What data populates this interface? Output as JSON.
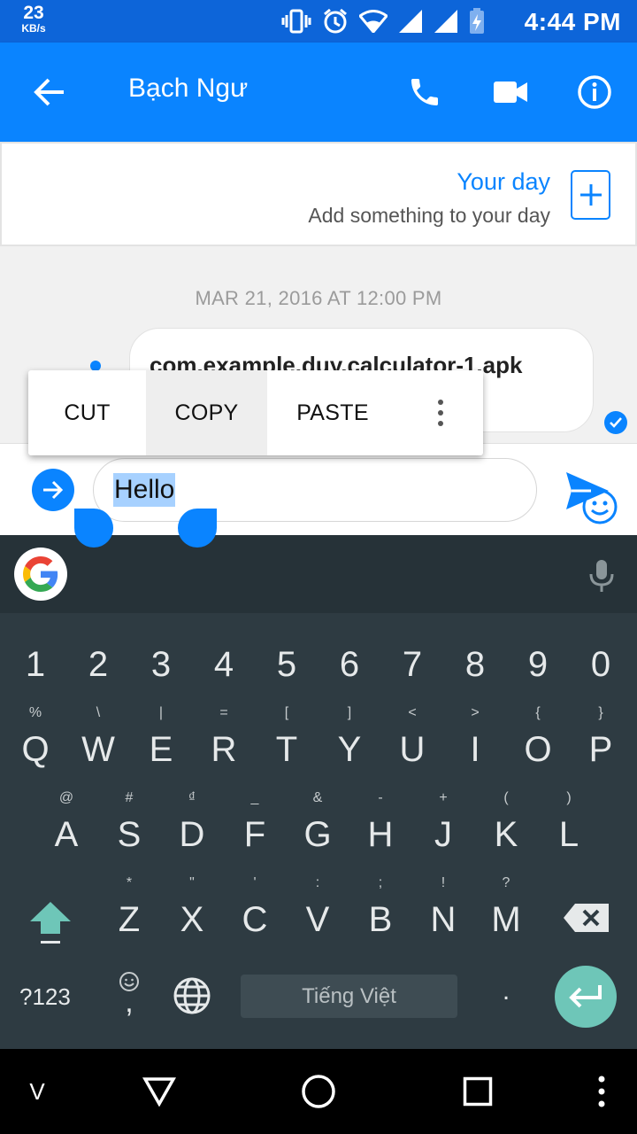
{
  "status_bar": {
    "net_speed": "23",
    "net_unit": "KB/s",
    "time": "4:44 PM",
    "icons": [
      "vibrate-icon",
      "alarm-icon",
      "wifi-icon",
      "signal-icon",
      "signal-icon",
      "battery-charging-icon"
    ]
  },
  "header": {
    "contact_name": "Bạch Ngư",
    "icons": [
      "back-arrow-icon",
      "phone-icon",
      "video-camera-icon",
      "info-icon"
    ]
  },
  "your_day": {
    "title": "Your day",
    "subtitle": "Add something to your day"
  },
  "conversation": {
    "timestamp": "MAR 21, 2016 AT 12:00 PM",
    "message": "com.example.duy.calculator-1.apk"
  },
  "context_menu": {
    "cut": "CUT",
    "copy": "COPY",
    "paste": "PASTE"
  },
  "composer": {
    "value": "Hello"
  },
  "keyboard": {
    "number_row": [
      "1",
      "2",
      "3",
      "4",
      "5",
      "6",
      "7",
      "8",
      "9",
      "0"
    ],
    "row1": [
      {
        "key": "Q",
        "hint": "%"
      },
      {
        "key": "W",
        "hint": "\\"
      },
      {
        "key": "E",
        "hint": "|"
      },
      {
        "key": "R",
        "hint": "="
      },
      {
        "key": "T",
        "hint": "["
      },
      {
        "key": "Y",
        "hint": "]"
      },
      {
        "key": "U",
        "hint": "<"
      },
      {
        "key": "I",
        "hint": ">"
      },
      {
        "key": "O",
        "hint": "{"
      },
      {
        "key": "P",
        "hint": "}"
      }
    ],
    "row2": [
      {
        "key": "A",
        "hint": "@"
      },
      {
        "key": "S",
        "hint": "#"
      },
      {
        "key": "D",
        "hint": "₫"
      },
      {
        "key": "F",
        "hint": "_"
      },
      {
        "key": "G",
        "hint": "&"
      },
      {
        "key": "H",
        "hint": "-"
      },
      {
        "key": "J",
        "hint": "+"
      },
      {
        "key": "K",
        "hint": "("
      },
      {
        "key": "L",
        "hint": ")"
      }
    ],
    "row3": [
      {
        "key": "Z",
        "hint": "*"
      },
      {
        "key": "X",
        "hint": "\""
      },
      {
        "key": "C",
        "hint": "'"
      },
      {
        "key": "V",
        "hint": ":"
      },
      {
        "key": "B",
        "hint": ";"
      },
      {
        "key": "N",
        "hint": "!"
      },
      {
        "key": "M",
        "hint": "?"
      }
    ],
    "symbols_label": "?123",
    "emoji_comma_label": ",",
    "space_label": "Tiếng Việt",
    "period_label": "."
  },
  "nav_bar": {
    "left_label": "V",
    "icons": [
      "back-triangle-icon",
      "home-circle-icon",
      "recents-square-icon",
      "more-vert-icon"
    ]
  },
  "colors": {
    "status_bar": "#0d65d9",
    "app_bar": "#0a84ff",
    "keyboard": "#2e3b42",
    "enter_key": "#6ec6b8",
    "selection": "#a7d1ff"
  }
}
